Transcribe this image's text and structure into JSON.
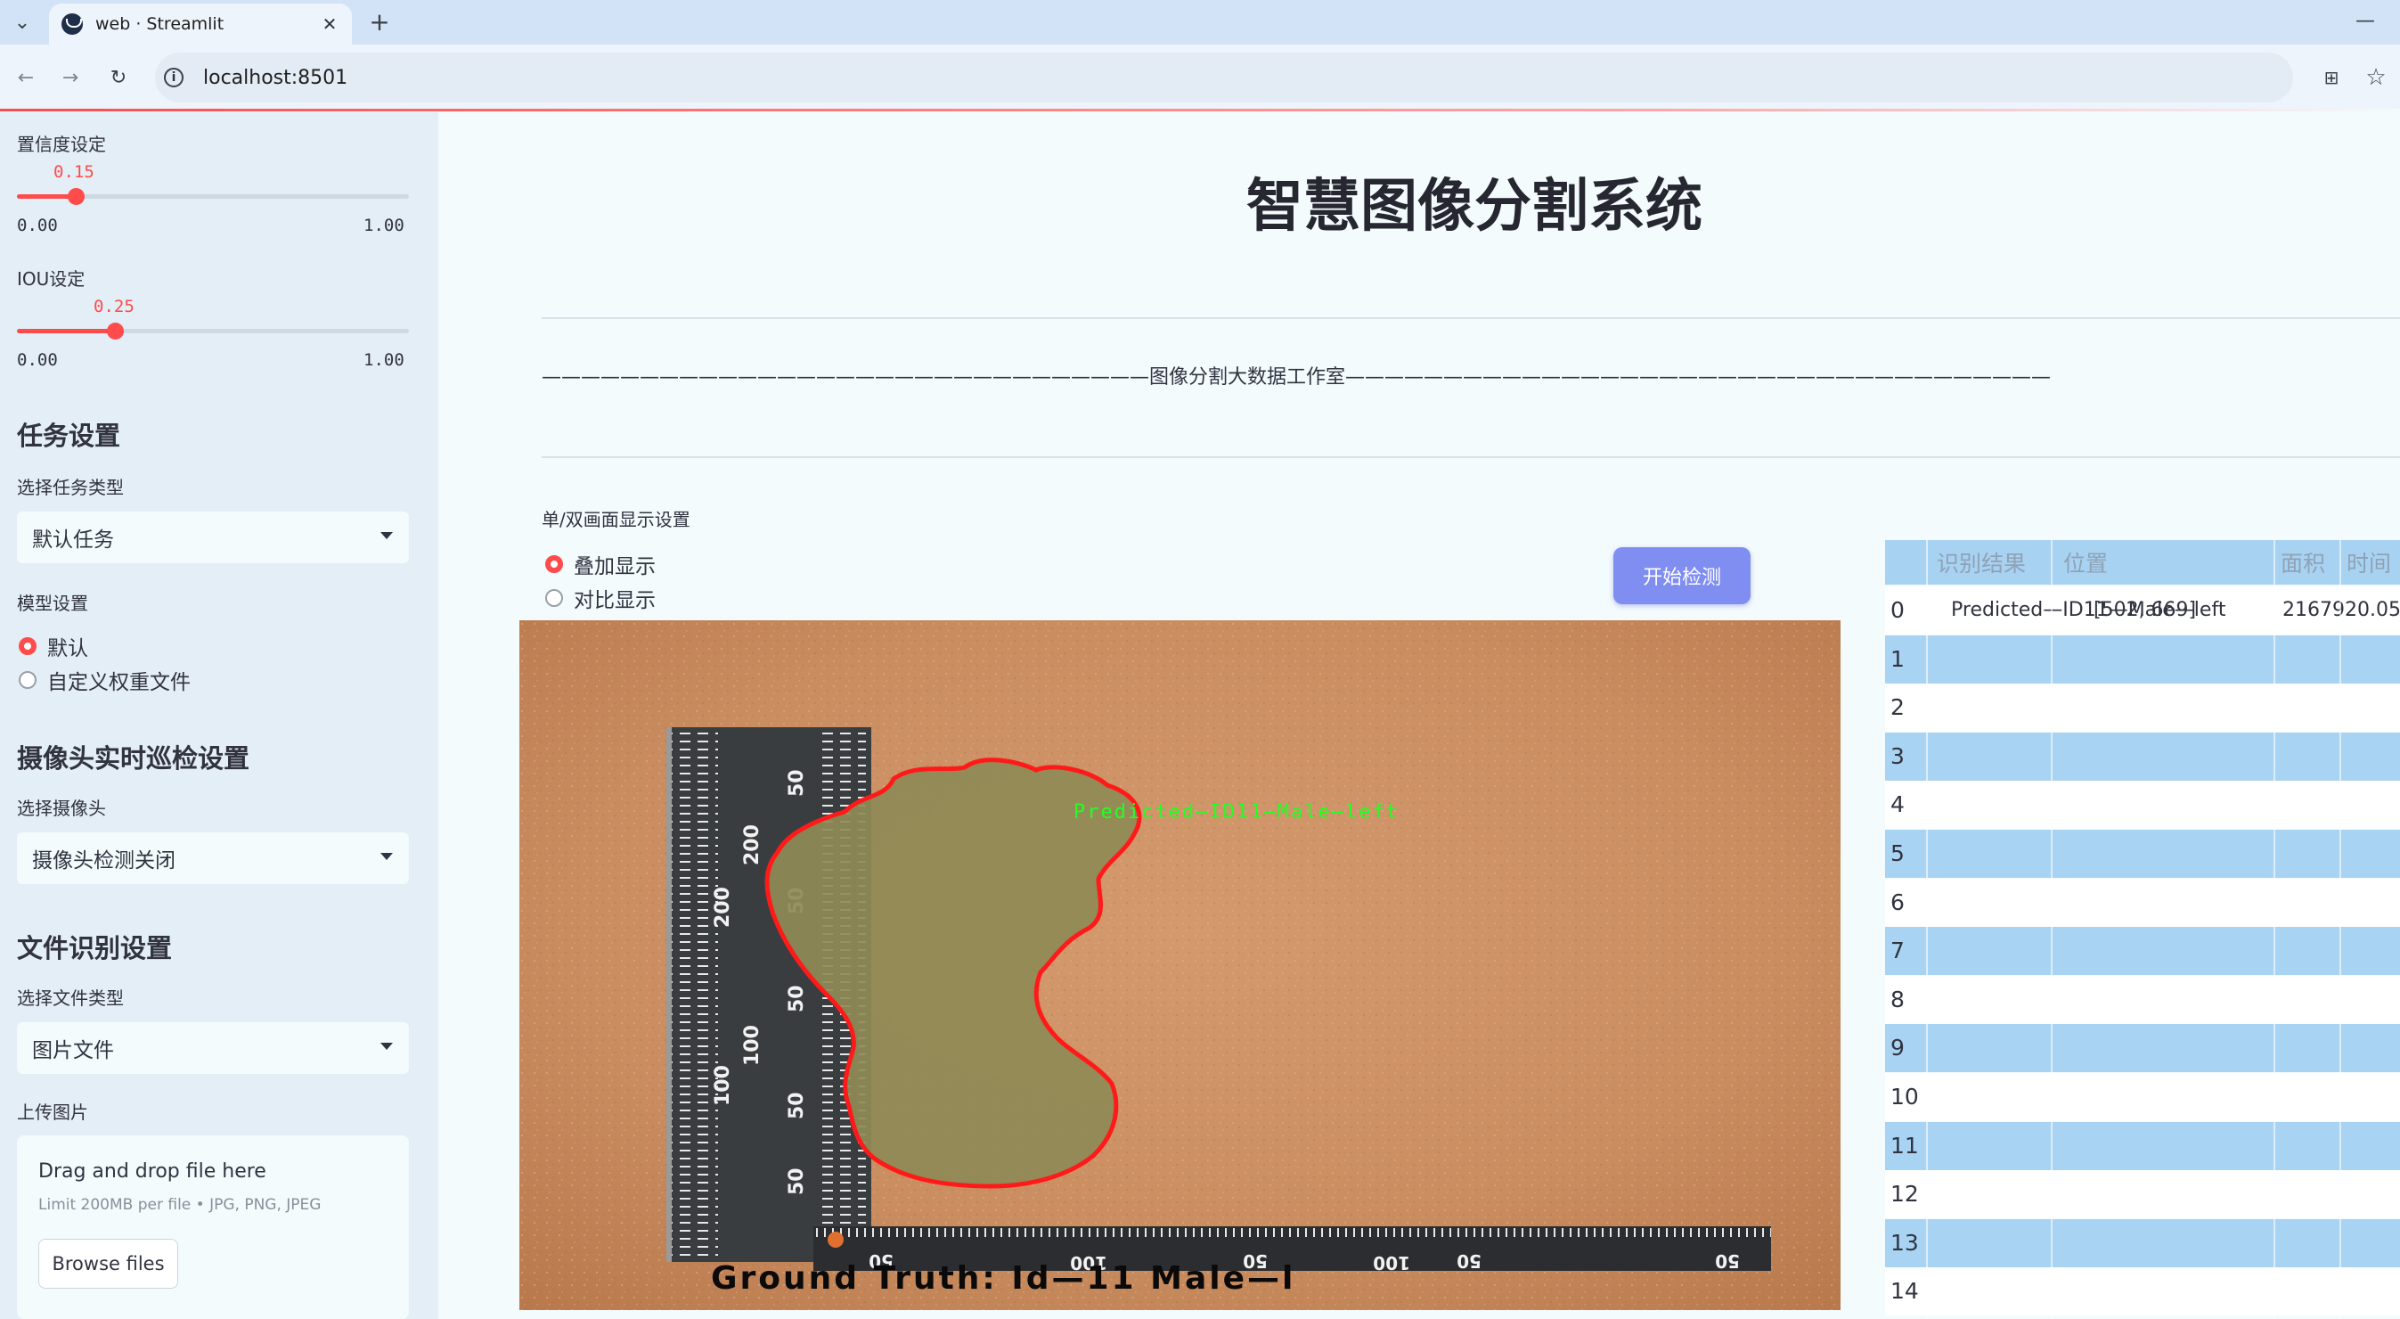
{
  "browser": {
    "tab_title": "web · Streamlit",
    "url": "localhost:8501"
  },
  "sidebar": {
    "confidence": {
      "label": "置信度设定",
      "value": "0.15",
      "value_num": 0.15,
      "min": "0.00",
      "max": "1.00"
    },
    "iou": {
      "label": "IOU设定",
      "value": "0.25",
      "value_num": 0.25,
      "min": "0.00",
      "max": "1.00"
    },
    "task_header": "任务设置",
    "task_select_label": "选择任务类型",
    "task_select_value": "默认任务",
    "model_label": "模型设置",
    "model_options": [
      "默认",
      "自定义权重文件"
    ],
    "camera_header": "摄像头实时巡检设置",
    "camera_select_label": "选择摄像头",
    "camera_select_value": "摄像头检测关闭",
    "file_header": "文件识别设置",
    "file_select_label": "选择文件类型",
    "file_select_value": "图片文件",
    "upload_label": "上传图片",
    "upload_title": "Drag and drop file here",
    "upload_hint": "Limit 200MB per file • JPG, PNG, JPEG",
    "browse_label": "Browse files"
  },
  "main": {
    "title": "智慧图像分割系统",
    "subtitle": "———————————————————————————————图像分割大数据工作室————————————————————————————————————",
    "display_label": "单/双画面显示设置",
    "display_options": [
      "叠加显示",
      "对比显示"
    ],
    "start_button": "开始检测",
    "image_overlay": {
      "predicted_label": "Predicted—ID11—Male—left",
      "ground_truth_label": "Ground Truth: Id—11 Male—l",
      "ruler_vertical_marks": [
        "50",
        "200",
        "50",
        "200",
        "50",
        "100",
        "50",
        "100",
        "50"
      ],
      "ruler_horizontal_marks": [
        "50",
        "100",
        "50",
        "50",
        "100",
        "50"
      ]
    }
  },
  "results": {
    "columns": [
      "",
      "识别结果",
      "位置",
      "面积",
      "时间"
    ],
    "rows": [
      {
        "idx": "0",
        "label": "Predicted—ID11—Male—left",
        "position": "[502, 669]",
        "area": "2167920.05"
      },
      {
        "idx": "1"
      },
      {
        "idx": "2"
      },
      {
        "idx": "3"
      },
      {
        "idx": "4"
      },
      {
        "idx": "5"
      },
      {
        "idx": "6"
      },
      {
        "idx": "7"
      },
      {
        "idx": "8"
      },
      {
        "idx": "9"
      },
      {
        "idx": "10"
      },
      {
        "idx": "11"
      },
      {
        "idx": "12"
      },
      {
        "idx": "13"
      },
      {
        "idx": "14"
      }
    ]
  },
  "colors": {
    "accent": "#ff4b4b",
    "button": "#7f8ef0",
    "table_stripe": "#a9d3f3",
    "mask_outline": "#ff1a1a",
    "predicted_label": "#22ff22"
  }
}
